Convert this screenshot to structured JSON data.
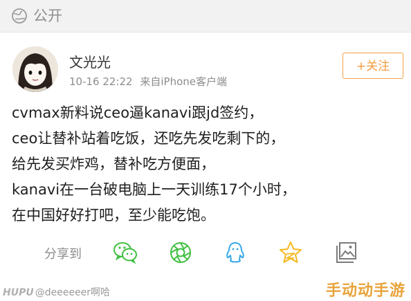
{
  "header": {
    "visibility_label": "公开",
    "icon": "globe-icon"
  },
  "post": {
    "author": "文光光",
    "timestamp": "10-16 22:22",
    "source": "来自iPhone客户端",
    "follow_label": "+关注",
    "lines": [
      "cvmax新料说ceo逼kanavi跟jd签约，",
      "ceo让替补站着吃饭，还吃先发吃剩下的，",
      "给先发买炸鸡，替补吃方便面，",
      "kanavi在一台破电脑上一天训练17个小时，",
      "在中国好好打吧，至少能吃饱。"
    ]
  },
  "share": {
    "label": "分享到",
    "targets": [
      "wechat-icon",
      "moments-icon",
      "qq-icon",
      "qzone-icon",
      "share-image-icon"
    ]
  },
  "watermarks": {
    "left_brand": "HUPU",
    "left_handle": "@deeeeeer啊哈",
    "right": "手动动手游"
  },
  "colors": {
    "accent_orange": "#f39b3b",
    "share_green": "#3fbf3f",
    "share_blue": "#35a7e8",
    "share_gold": "#f5b81e",
    "share_grey": "#7b7b7b"
  }
}
